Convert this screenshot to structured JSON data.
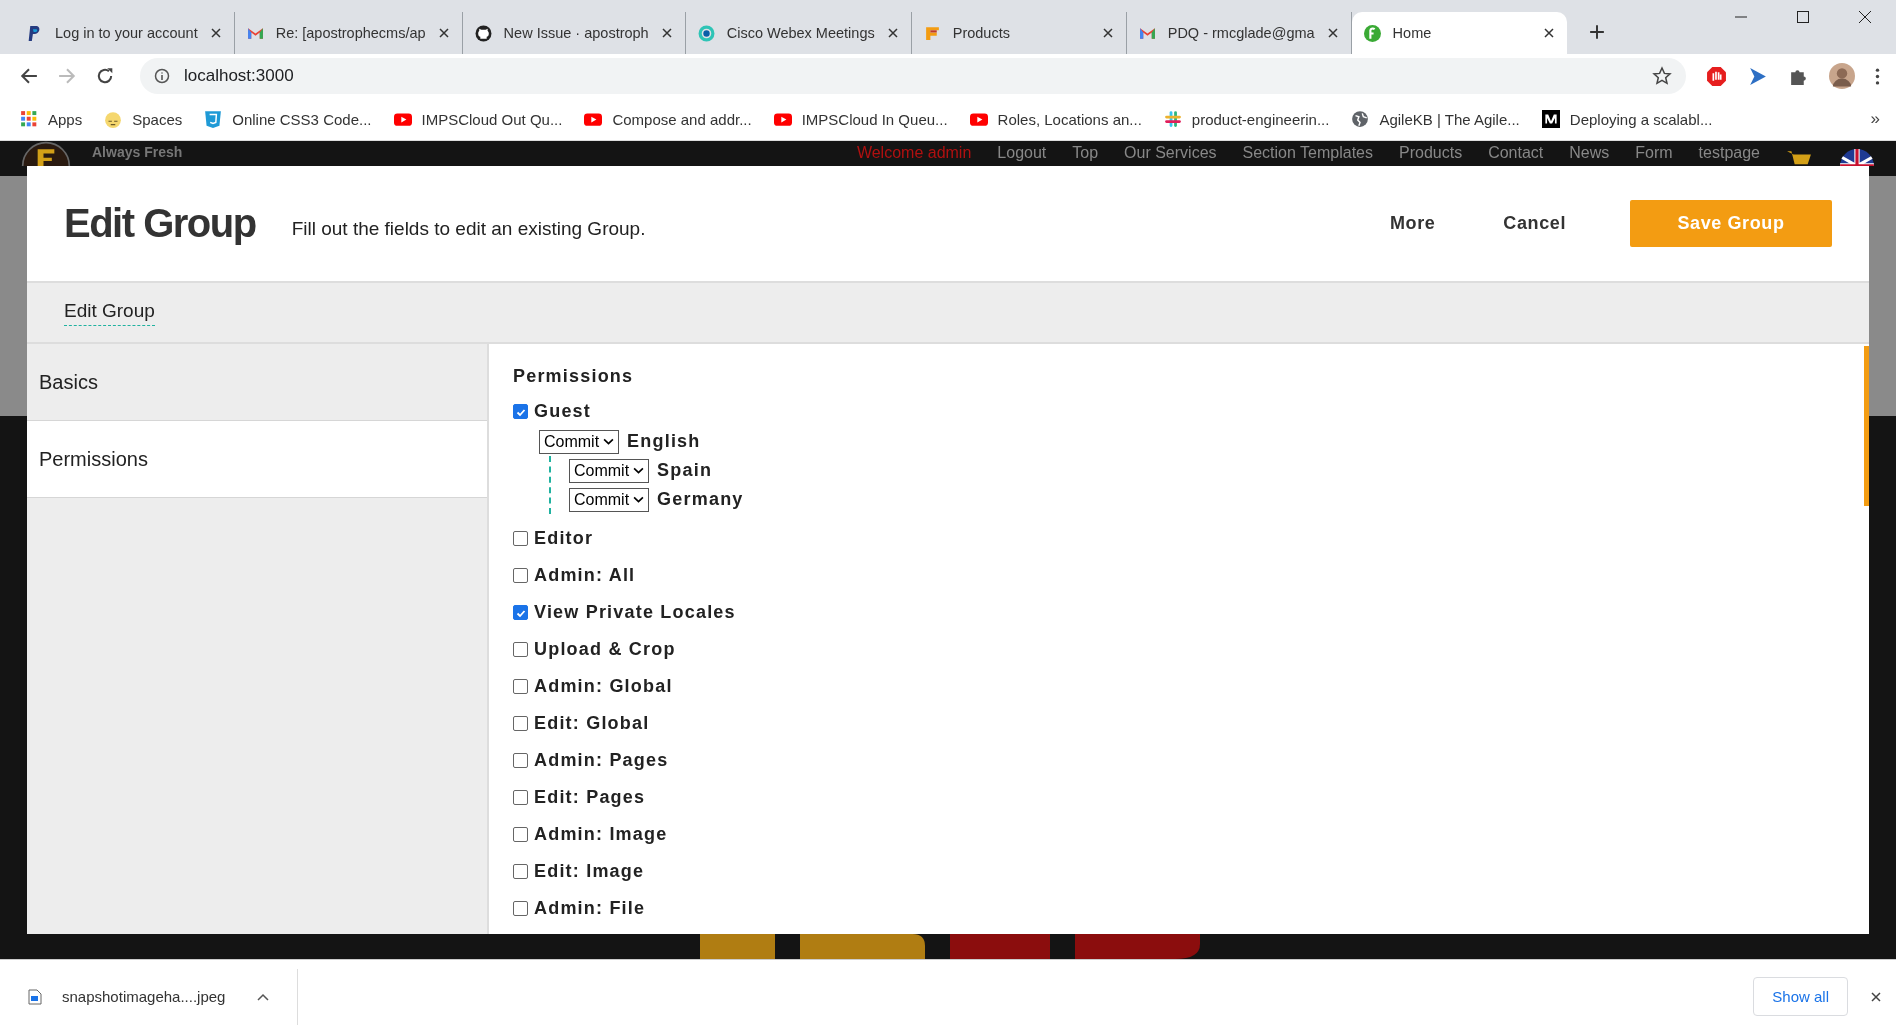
{
  "browser": {
    "tabs": [
      {
        "title": "Log in to your account",
        "kind": "paypal",
        "selected": false
      },
      {
        "title": "Re: [apostrophecms/ap",
        "kind": "gmail",
        "selected": false
      },
      {
        "title": "New Issue · apostroph",
        "kind": "github",
        "selected": false
      },
      {
        "title": "Cisco Webex Meetings",
        "kind": "webex",
        "selected": false
      },
      {
        "title": "Products",
        "kind": "products",
        "selected": false
      },
      {
        "title": "PDQ - rmcglade@gma",
        "kind": "gmail",
        "selected": false
      },
      {
        "title": "Home",
        "kind": "home",
        "selected": true
      }
    ],
    "address": "localhost:3000",
    "bookmarks": [
      {
        "label": "Apps",
        "kind": "apps"
      },
      {
        "label": "Spaces",
        "kind": "spaces"
      },
      {
        "label": "Online CSS3 Code...",
        "kind": "css"
      },
      {
        "label": "IMPSCloud Out Qu...",
        "kind": "youtube"
      },
      {
        "label": "Compose and addr...",
        "kind": "youtube"
      },
      {
        "label": "IMPSCloud In Queu...",
        "kind": "youtube"
      },
      {
        "label": "Roles, Locations an...",
        "kind": "youtube"
      },
      {
        "label": "product-engineerin...",
        "kind": "slack"
      },
      {
        "label": "AgileKB | The Agile...",
        "kind": "globe"
      },
      {
        "label": "Deploying a scalabl...",
        "kind": "medium"
      }
    ],
    "bookmarks_more": "»"
  },
  "site_header": {
    "tagline": "Always Fresh",
    "nav": [
      {
        "label": "Welcome admin",
        "kind": "greeting"
      },
      {
        "label": "Logout",
        "kind": "link"
      },
      {
        "label": "Top",
        "kind": "link"
      },
      {
        "label": "Our Services",
        "kind": "link"
      },
      {
        "label": "Section Templates",
        "kind": "link"
      },
      {
        "label": "Products",
        "kind": "link"
      },
      {
        "label": "Contact",
        "kind": "link"
      },
      {
        "label": "News",
        "kind": "link"
      },
      {
        "label": "Form",
        "kind": "link"
      },
      {
        "label": "testpage",
        "kind": "link"
      }
    ]
  },
  "modal": {
    "title": "Edit Group",
    "description": "Fill out the fields to edit an existing Group.",
    "buttons": [
      {
        "label": "More",
        "kind": "plain"
      },
      {
        "label": "Cancel",
        "kind": "plain"
      },
      {
        "label": "Save Group",
        "kind": "primary"
      }
    ],
    "breadcrumbs": [
      {
        "label": "Edit Group",
        "selected": true
      }
    ],
    "sidebar": [
      {
        "label": "Basics",
        "selected": false
      },
      {
        "label": "Permissions",
        "selected": true
      }
    ],
    "section_title": "Permissions",
    "permissions": [
      {
        "label": "Guest",
        "checked": true,
        "locales": [
          {
            "name": "English",
            "mode": "Commit",
            "children": [
              {
                "name": "Spain",
                "mode": "Commit"
              },
              {
                "name": "Germany",
                "mode": "Commit"
              }
            ]
          }
        ]
      },
      {
        "label": "Editor",
        "checked": false
      },
      {
        "label": "Admin: All",
        "checked": false
      },
      {
        "label": "View Private Locales",
        "checked": true
      },
      {
        "label": "Upload & Crop",
        "checked": false
      },
      {
        "label": "Admin: Global",
        "checked": false
      },
      {
        "label": "Edit: Global",
        "checked": false
      },
      {
        "label": "Admin: Pages",
        "checked": false
      },
      {
        "label": "Edit: Pages",
        "checked": false
      },
      {
        "label": "Admin: Image",
        "checked": false
      },
      {
        "label": "Edit: Image",
        "checked": false
      },
      {
        "label": "Admin: File",
        "checked": false
      }
    ]
  },
  "downloads": {
    "file": "snapshotimageha....jpeg",
    "show_all": "Show all"
  }
}
